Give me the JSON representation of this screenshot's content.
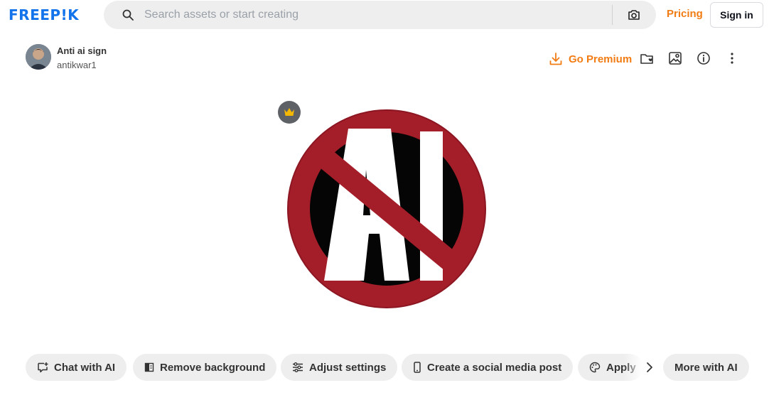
{
  "header": {
    "logo_text": "FREEP!K",
    "search_placeholder": "Search assets or start creating",
    "pricing_label": "Pricing",
    "signin_label": "Sign in"
  },
  "asset": {
    "title": "Anti ai sign",
    "author": "antikwar1"
  },
  "actions": {
    "go_premium_label": "Go Premium"
  },
  "chips": [
    {
      "label": "Chat with AI",
      "icon": "chat-plus-icon"
    },
    {
      "label": "Remove background",
      "icon": "remove-bg-icon"
    },
    {
      "label": "Adjust settings",
      "icon": "sliders-icon"
    },
    {
      "label": "Create a social media post",
      "icon": "phone-icon"
    },
    {
      "label": "Apply",
      "icon": "palette-icon"
    },
    {
      "label": "More with AI",
      "icon": ""
    }
  ],
  "image": {
    "sign_text": "AI"
  },
  "colors": {
    "brand": "#1273eb",
    "accent_orange": "#f27c14",
    "sign_red": "#a41e2a",
    "crown_yellow": "#f5b800"
  }
}
